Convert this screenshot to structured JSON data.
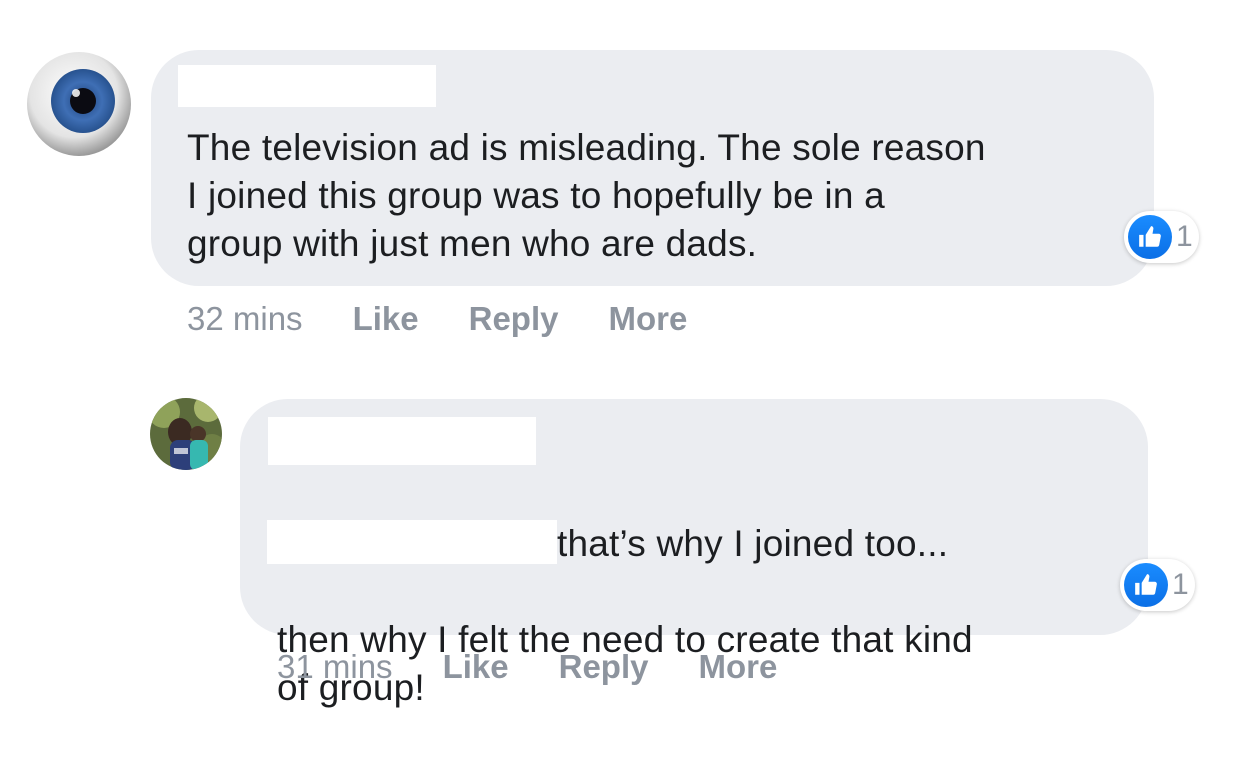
{
  "comments": [
    {
      "author": "",
      "text": "The television ad is misleading. The sole reason\nI joined this group was to hopefully be in a\ngroup with just men who are dads.",
      "reaction_count": "1",
      "time": "32 mins",
      "actions": {
        "like": "Like",
        "reply": "Reply",
        "more": "More"
      },
      "avatar_icon": "eyeball-avatar"
    },
    {
      "author": "",
      "mention": "",
      "text_after_mention": "that’s why I joined too...",
      "text": "then why I felt the need to create that kind\nof group!",
      "reaction_count": "1",
      "time": "31 mins",
      "actions": {
        "like": "Like",
        "reply": "Reply",
        "more": "More"
      },
      "avatar_icon": "photo-avatar"
    }
  ],
  "colors": {
    "bubble": "#ebedf1",
    "text": "#1c1e21",
    "meta": "#8d949e",
    "like_blue": "#1877f2"
  }
}
